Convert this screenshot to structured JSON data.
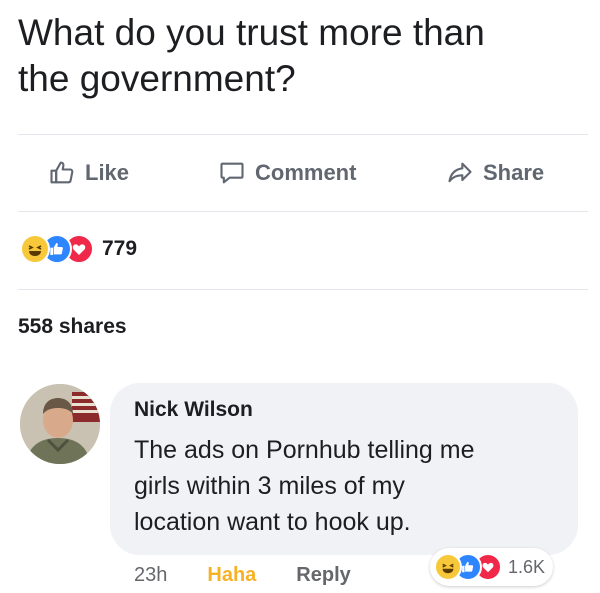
{
  "post": {
    "text_line1": "What do you trust more than",
    "text_line2": "the government?"
  },
  "actions": {
    "like_label": "Like",
    "comment_label": "Comment",
    "share_label": "Share"
  },
  "reactions": {
    "icons": [
      "haha-icon",
      "like-icon",
      "love-icon"
    ],
    "count": "779"
  },
  "shares": "558 shares",
  "comment": {
    "author": "Nick Wilson",
    "text_line1": "The ads on Pornhub telling me",
    "text_line2": "girls within 3 miles of my",
    "text_line3": "location want to hook up.",
    "time": "23h",
    "haha_label": "Haha",
    "reply_label": "Reply",
    "reaction_count": "1.6K"
  },
  "colors": {
    "text": "#1c1e21",
    "secondary": "#606770",
    "haha": "#f7c93a",
    "like": "#2d86ff",
    "love": "#f02849",
    "bubble": "#f0f2f5"
  }
}
